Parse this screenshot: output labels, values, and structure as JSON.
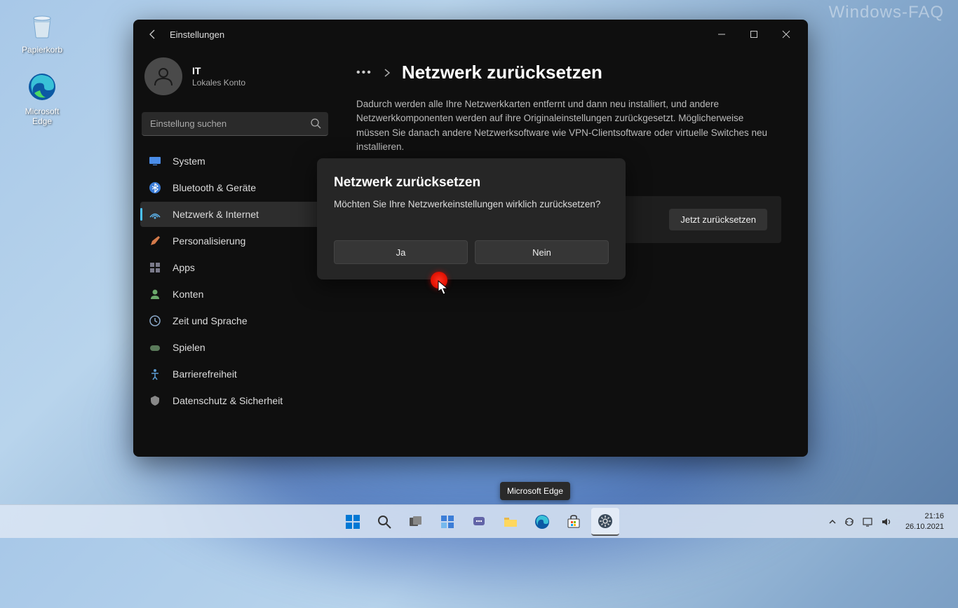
{
  "watermark": "Windows-FAQ",
  "desktop": {
    "recycle_bin": "Papierkorb",
    "edge": "Microsoft Edge"
  },
  "window": {
    "title": "Einstellungen",
    "user": {
      "name": "IT",
      "subtitle": "Lokales Konto"
    },
    "search_placeholder": "Einstellung suchen",
    "nav": [
      {
        "label": "System"
      },
      {
        "label": "Bluetooth & Geräte"
      },
      {
        "label": "Netzwerk & Internet"
      },
      {
        "label": "Personalisierung"
      },
      {
        "label": "Apps"
      },
      {
        "label": "Konten"
      },
      {
        "label": "Zeit und Sprache"
      },
      {
        "label": "Spielen"
      },
      {
        "label": "Barrierefreiheit"
      },
      {
        "label": "Datenschutz & Sicherheit"
      }
    ],
    "breadcrumb_page": "Netzwerk zurücksetzen",
    "description": "Dadurch werden alle Ihre Netzwerkkarten entfernt und dann neu installiert, und andere Netzwerkkomponenten werden auf ihre Originaleinstellungen zurückgesetzt. Möglicherweise müssen Sie danach andere Netzwerksoftware wie VPN-Clientsoftware oder virtuelle Switches neu installieren.",
    "reset_button": "Jetzt zurücksetzen"
  },
  "dialog": {
    "title": "Netzwerk zurücksetzen",
    "message": "Möchten Sie Ihre Netzwerkeinstellungen wirklich zurücksetzen?",
    "yes": "Ja",
    "no": "Nein"
  },
  "tooltip": "Microsoft Edge",
  "tray": {
    "time": "21:16",
    "date": "26.10.2021"
  }
}
